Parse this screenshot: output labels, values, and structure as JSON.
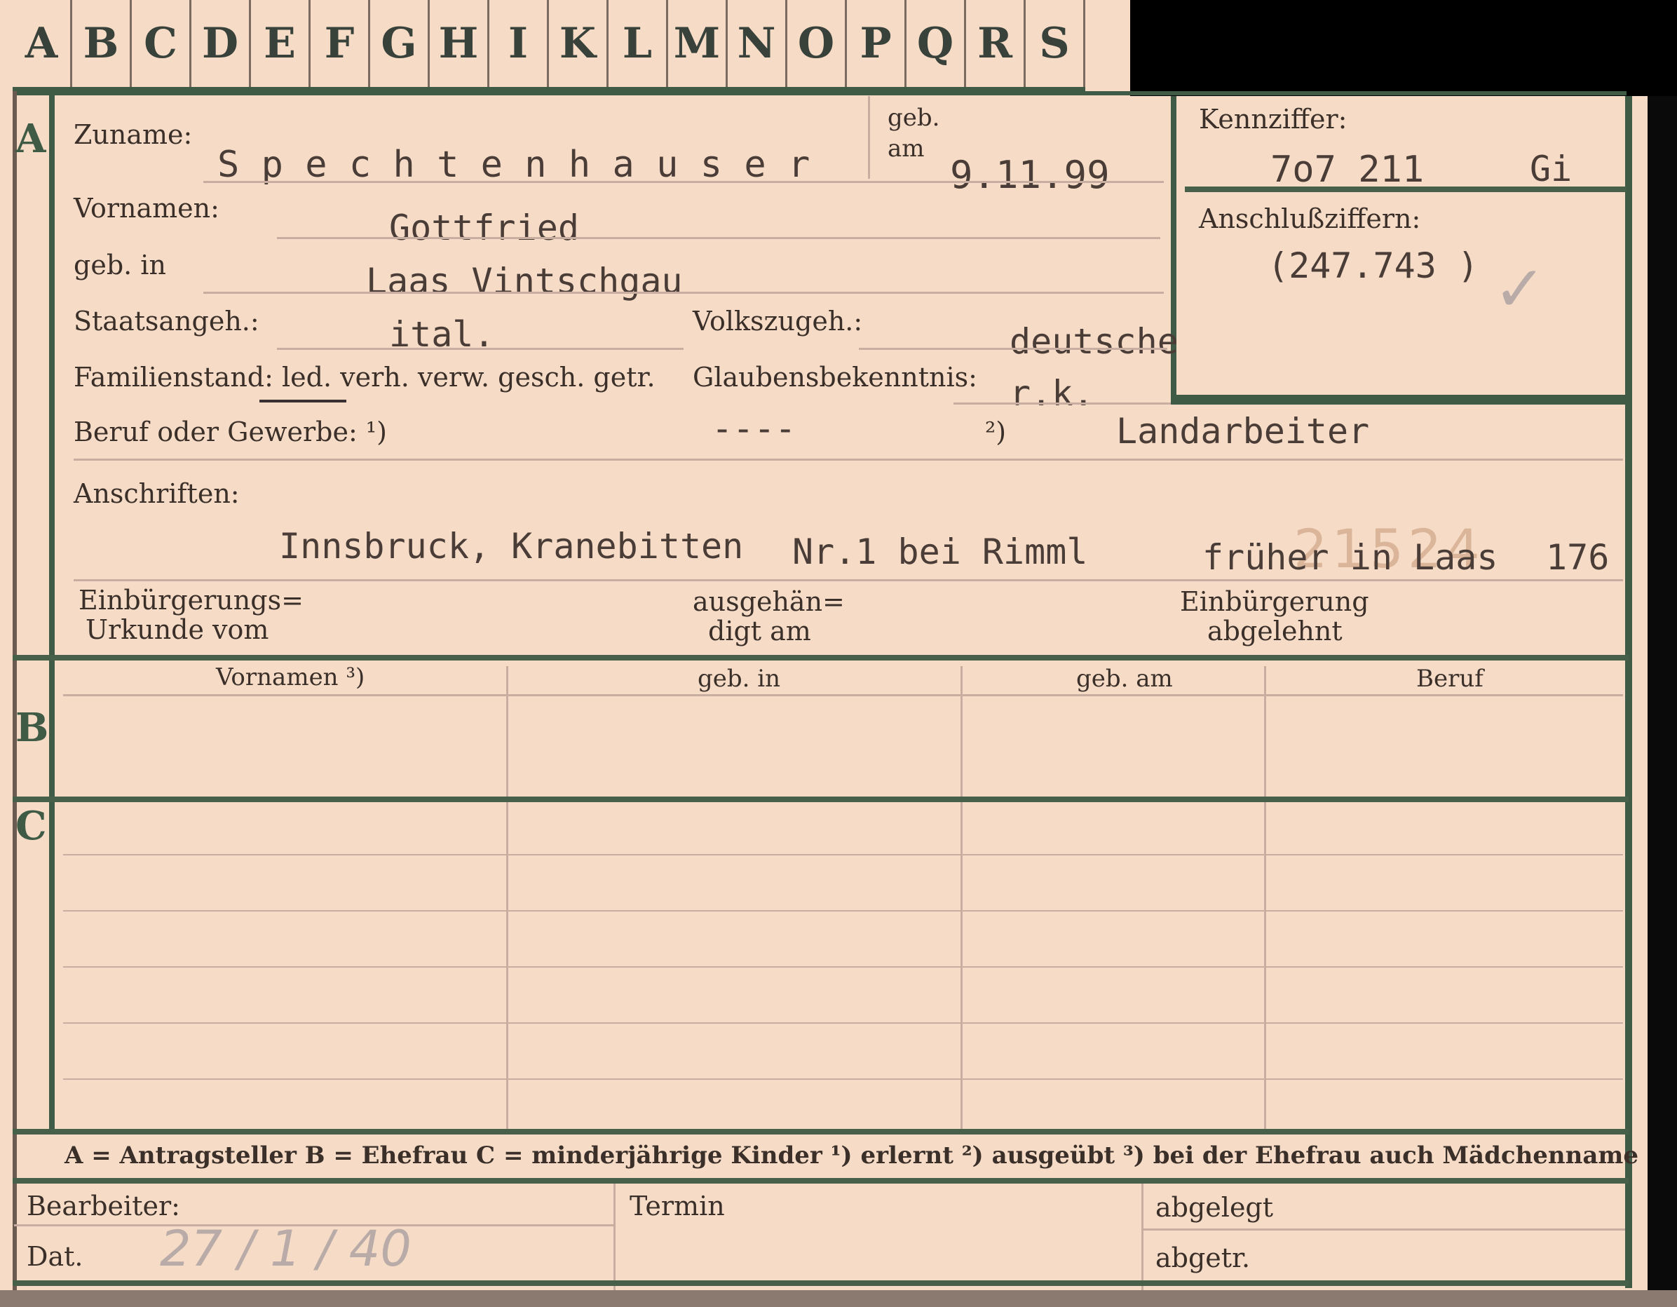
{
  "tabs": [
    "A",
    "B",
    "C",
    "D",
    "E",
    "F",
    "G",
    "H",
    "I",
    "K",
    "L",
    "M",
    "N",
    "O",
    "P",
    "Q",
    "R",
    "S"
  ],
  "sections": {
    "a": "A",
    "b": "B",
    "c": "C"
  },
  "fields": {
    "zuname_label": "Zuname:",
    "zuname_value": "S p e c h t e n h a u s e r",
    "geb_label_1": "geb.",
    "geb_label_2": "am",
    "geb_am_value": "9.11.99",
    "kennziffer_label": "Kennziffer:",
    "kennziffer_value": "7o7 211",
    "kennziffer_suffix": "Gi",
    "anschluss_label": "Anschlußziffern:",
    "anschluss_value": "(247.743 )",
    "vornamen_label": "Vornamen:",
    "vornamen_value": "Gottfried",
    "geb_in_label": "geb. in",
    "geb_in_value": "Laas Vintschgau",
    "staatsangeh_label": "Staatsangeh.:",
    "staatsangeh_value": "ital.",
    "volkszugeh_label": "Volkszugeh.:",
    "volkszugeh_value": "deutsche",
    "familienstand_label": "Familienstand: led. verh. verw. gesch. getr.",
    "glaubens_label": "Glaubensbekenntnis:",
    "glaubens_value": "r.k.",
    "beruf_label": "Beruf oder Gewerbe: ¹)",
    "beruf_1_value": "----",
    "beruf_2_label": "²)",
    "beruf_2_value": "Landarbeiter",
    "anschriften_label": "Anschriften:",
    "anschrift_1": "Innsbruck, Kranebitten",
    "anschrift_2": "Nr.1 bei Rimml",
    "anschrift_3": "früher in Laas",
    "anschrift_4": "176",
    "stamp_number": "21524",
    "einbuergerung_1": "Einbürgerungs=",
    "einbuergerung_2": "Urkunde vom",
    "ausgehaen_1": "ausgehän=",
    "ausgehaen_2": "digt am",
    "abgelehnt_1": "Einbürgerung",
    "abgelehnt_2": "abgelehnt"
  },
  "table": {
    "headers": [
      "Vornamen ³)",
      "geb. in",
      "geb. am",
      "Beruf"
    ]
  },
  "legend": "A = Antragsteller   B = Ehefrau   C = minderjährige Kinder   ¹) erlernt   ²) ausgeübt   ³) bei der Ehefrau auch Mädchenname",
  "footer": {
    "bearbeiter": "Bearbeiter:",
    "dat": "Dat.",
    "dat_value": "27 / 1 / 40",
    "termin": "Termin",
    "abgelegt": "abgelegt",
    "abgetr": "abgetr."
  }
}
